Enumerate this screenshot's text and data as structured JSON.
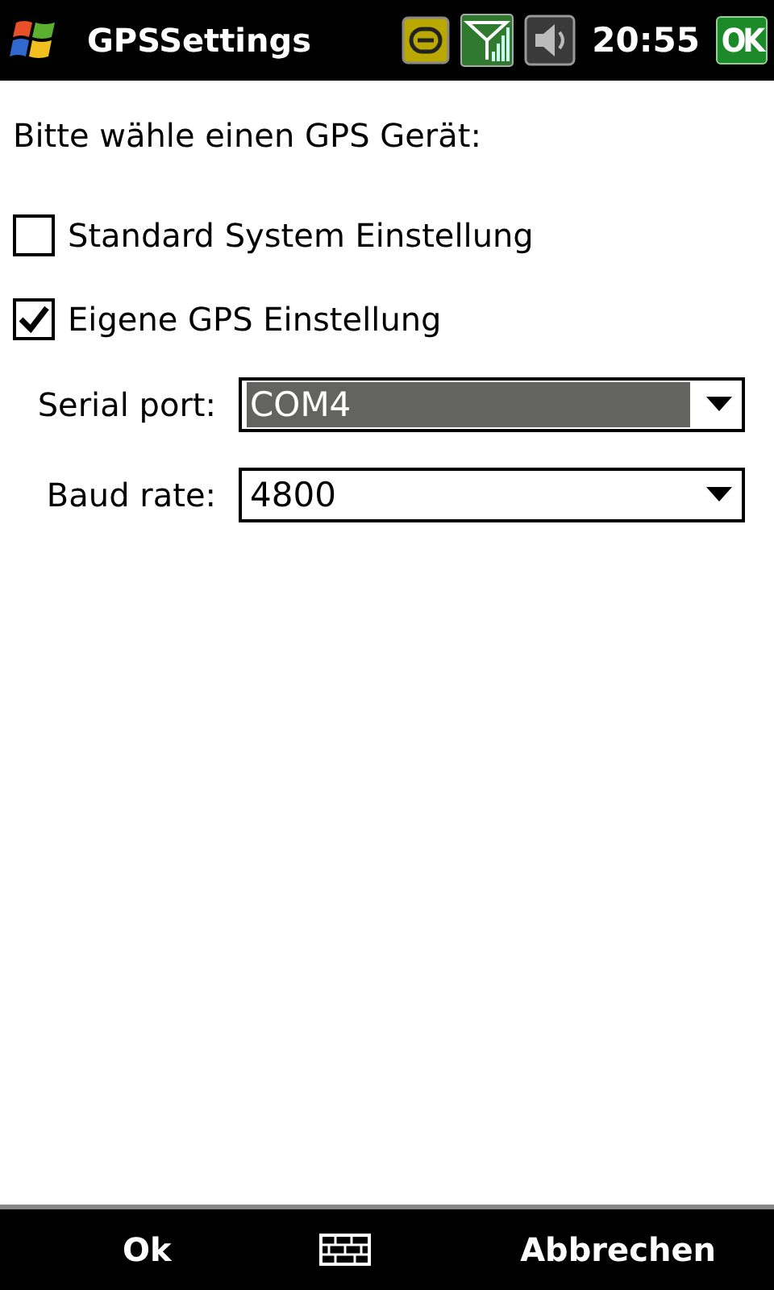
{
  "title_bar": {
    "title": "GPSSettings",
    "time": "20:55",
    "ok_label": "OK"
  },
  "prompt": "Bitte wähle einen GPS Gerät:",
  "options": [
    {
      "label": "Standard System Einstellung",
      "checked": false
    },
    {
      "label": "Eigene GPS Einstellung",
      "checked": true
    }
  ],
  "fields": [
    {
      "label": "Serial port:",
      "value": "COM4",
      "focused": true
    },
    {
      "label": "Baud rate:",
      "value": "4800",
      "focused": false
    }
  ],
  "soft_keys": {
    "left": "Ok",
    "right": "Abbrechen"
  }
}
